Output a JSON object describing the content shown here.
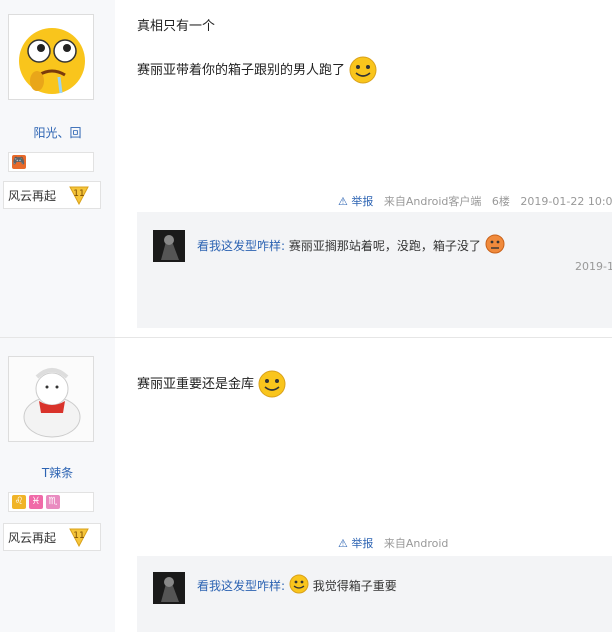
{
  "posts": [
    {
      "username": "阳光、回",
      "level_name": "风云再起",
      "level_num": "11",
      "line1": "真相只有一个",
      "line2": "赛丽亚带着你的箱子跟别的男人跑了",
      "report": "举报",
      "meta_text": "来自Android客户端",
      "floor": "6楼",
      "time": "2019-01-22 10:0",
      "reply": {
        "user": "看我这发型咋样:",
        "text": "赛丽亚搁那站着呢，没跑，箱子没了",
        "time": "2019-1"
      }
    },
    {
      "username": "T辣条",
      "level_name": "风云再起",
      "level_num": "11",
      "line1": "赛丽亚重要还是金库",
      "report": "举报",
      "meta_text": "来自Android",
      "reply": {
        "user": "看我这发型咋样:",
        "text": "我觉得箱子重要"
      }
    }
  ],
  "badges_post2": [
    "♌",
    "♓",
    "♏"
  ],
  "colors": {
    "link": "#2d64b3",
    "meta": "#999999",
    "level_badge": "#f5c53a",
    "sidebar": "#f7f8fa"
  }
}
